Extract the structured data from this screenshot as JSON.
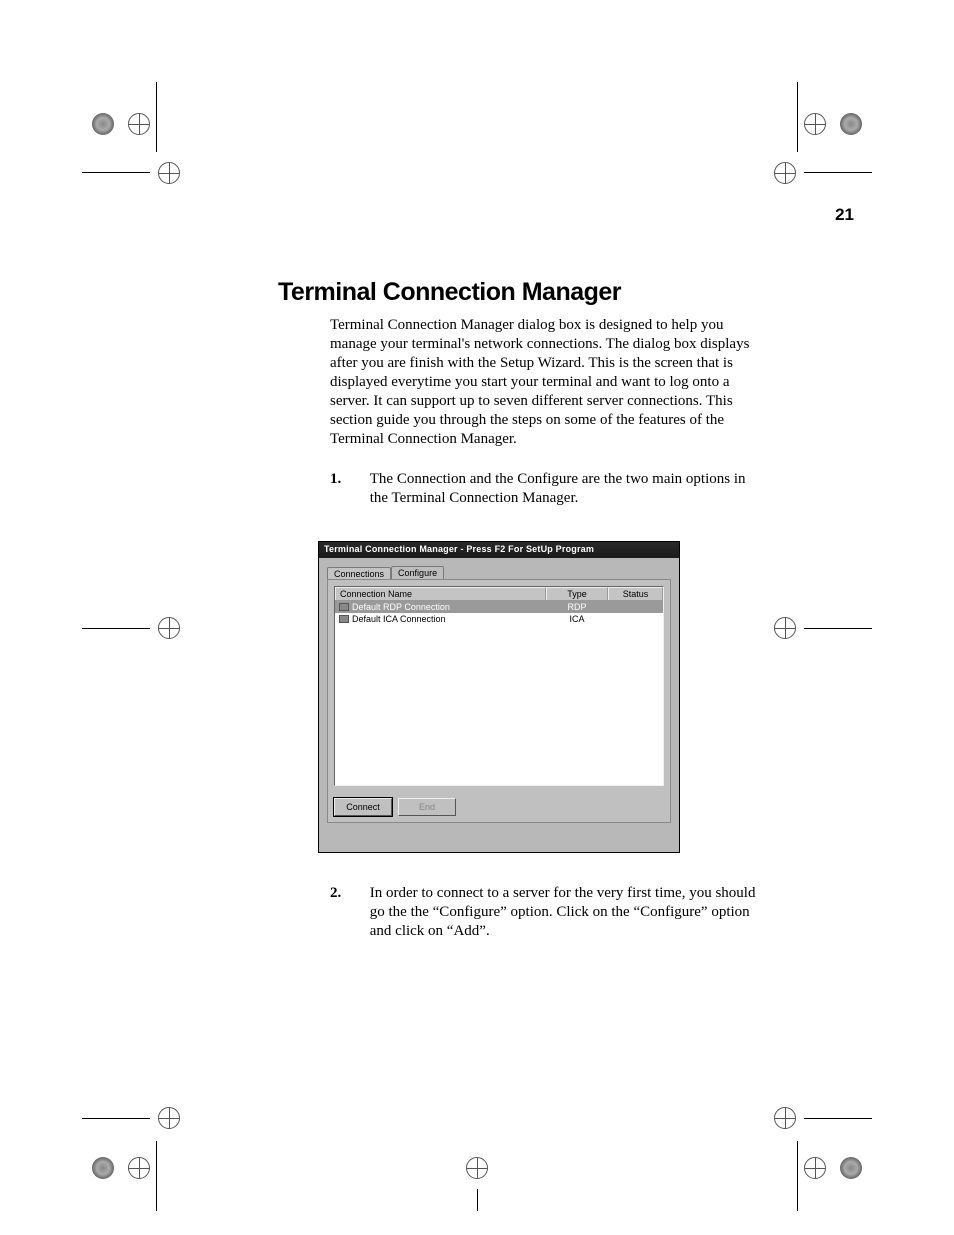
{
  "page_number": "21",
  "section_title": "Terminal Connection Manager",
  "intro_text": "Terminal Connection Manager dialog box is designed to help you manage your terminal's network connections. The dialog box displays after you are finish with the Setup Wizard.  This is the screen that is displayed everytime you start your terminal and want to log onto a server. It can support up to seven different server connections.  This section guide you through the steps on some of the features of the Terminal Connection Manager.",
  "steps": {
    "s1_num": "1.",
    "s1_text": "The Connection and the Configure are the two main options in the Terminal Connection Manager.",
    "s2_num": "2.",
    "s2_text": "In order to connect to a server for the very first time, you should go the the “Configure” option.  Click on the “Configure” option and click on “Add”."
  },
  "dialog": {
    "title": "Terminal Connection Manager - Press F2 For SetUp Program",
    "tabs": {
      "t1": "Connections",
      "t2": "Configure"
    },
    "columns": {
      "name": "Connection Name",
      "type": "Type",
      "status": "Status"
    },
    "rows": [
      {
        "name": "Default RDP Connection",
        "type": "RDP",
        "status": ""
      },
      {
        "name": "Default ICA Connection",
        "type": "ICA",
        "status": ""
      }
    ],
    "buttons": {
      "connect": "Connect",
      "end": "End"
    }
  }
}
